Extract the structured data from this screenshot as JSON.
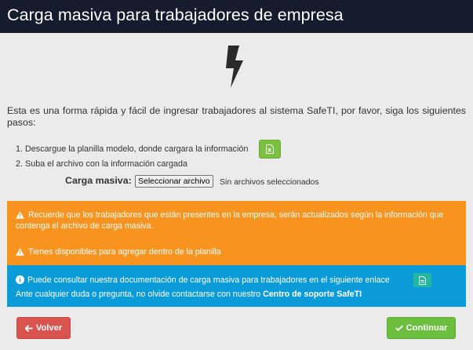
{
  "header": {
    "title": "Carga masiva para trabajadores de empresa"
  },
  "intro": {
    "text": "Esta es una forma rápida y fácil de ingresar trabajadores al sistema SafeTI, por favor, siga los siguientes pasos:"
  },
  "steps": [
    {
      "text": "1. Descargue la planilla modelo, donde cargara la información"
    },
    {
      "text": "2. Suba el archivo con la información cargada"
    }
  ],
  "upload": {
    "label": "Carga masiva:",
    "button_label": "Seleccionar archivo",
    "status": "Sin archivos seleccionados"
  },
  "warning": {
    "message1": "Recuerde que los trabajadores que están presentes en la empresa, serán actualizados según la información que contenga el archivo de carga masiva.",
    "message2": "Tienes disponibles para agregar dentro de la planilla"
  },
  "info": {
    "line1": "Puede consultar nuestra documentación de carga masiva para trabajadores en el siguiente enlace",
    "line2_prefix": "Ante cualquier duda o pregunta, no olvide contactarse con nuestro",
    "line2_link": "Centro de soporte SafeTI"
  },
  "buttons": {
    "back_label": "Volver",
    "continue_label": "Continuar"
  },
  "icons": {
    "logo": "lightning-bolt-icon",
    "download": "excel-file-icon",
    "warning": "warning-triangle-icon",
    "info": "info-circle-icon",
    "doc": "pdf-file-icon",
    "back": "arrow-left-icon",
    "continue": "check-icon"
  },
  "colors": {
    "header_bg": "#141c2e",
    "page_bg": "#ebebeb",
    "warning_bg": "#f7931e",
    "info_bg": "#0a9bd8",
    "back_button": "#d9534f",
    "continue_button": "#6cbf3e",
    "download_button": "#7ac142",
    "doc_button": "#22b7a1"
  }
}
